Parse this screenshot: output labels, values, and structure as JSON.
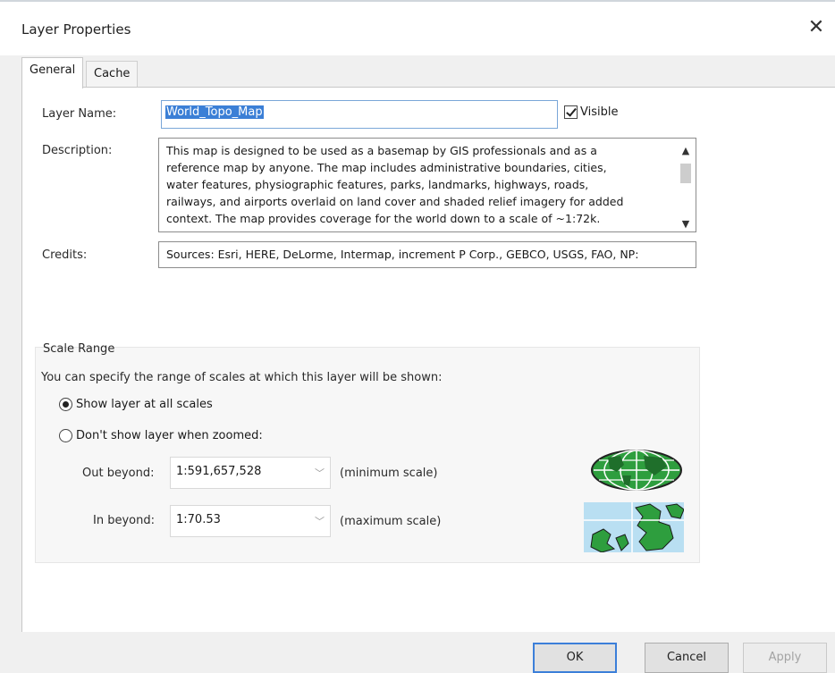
{
  "dialog": {
    "title": "Layer Properties"
  },
  "tabs": [
    {
      "label": "General"
    },
    {
      "label": "Cache"
    }
  ],
  "general": {
    "layer_name_label": "Layer Name:",
    "layer_name_value": "World_Topo_Map",
    "visible_label": "Visible",
    "visible_checked": true,
    "description_label": "Description:",
    "description_lines": [
      "This map is designed to be used as a basemap by GIS professionals and as a",
      "reference map by anyone. The map includes administrative boundaries, cities,",
      "water features, physiographic features, parks, landmarks, highways, roads,",
      "railways, and airports overlaid on land cover and shaded relief imagery for added",
      "context. The map provides coverage for the world down to a scale of ~1:72k."
    ],
    "credits_label": "Credits:",
    "credits_value": "Sources: Esri, HERE, DeLorme, Intermap, increment P Corp., GEBCO, USGS, FAO, NP:"
  },
  "scale_range": {
    "title": "Scale Range",
    "intro": "You can specify the range of scales at which this layer will be shown:",
    "option_all": "Show layer at all scales",
    "option_zoomed": "Don't show layer when zoomed:",
    "selected": "option_all",
    "out_beyond_label": "Out beyond:",
    "out_beyond_value": "1:591,657,528",
    "out_beyond_note": "(minimum scale)",
    "in_beyond_label": "In beyond:",
    "in_beyond_value": "1:70.53",
    "in_beyond_note": "(maximum scale)"
  },
  "footer": {
    "ok": "OK",
    "cancel": "Cancel",
    "apply": "Apply"
  },
  "colors": {
    "accent": "#3b7fd6",
    "map_green": "#2e9e3e",
    "map_water": "#b9dff2"
  }
}
